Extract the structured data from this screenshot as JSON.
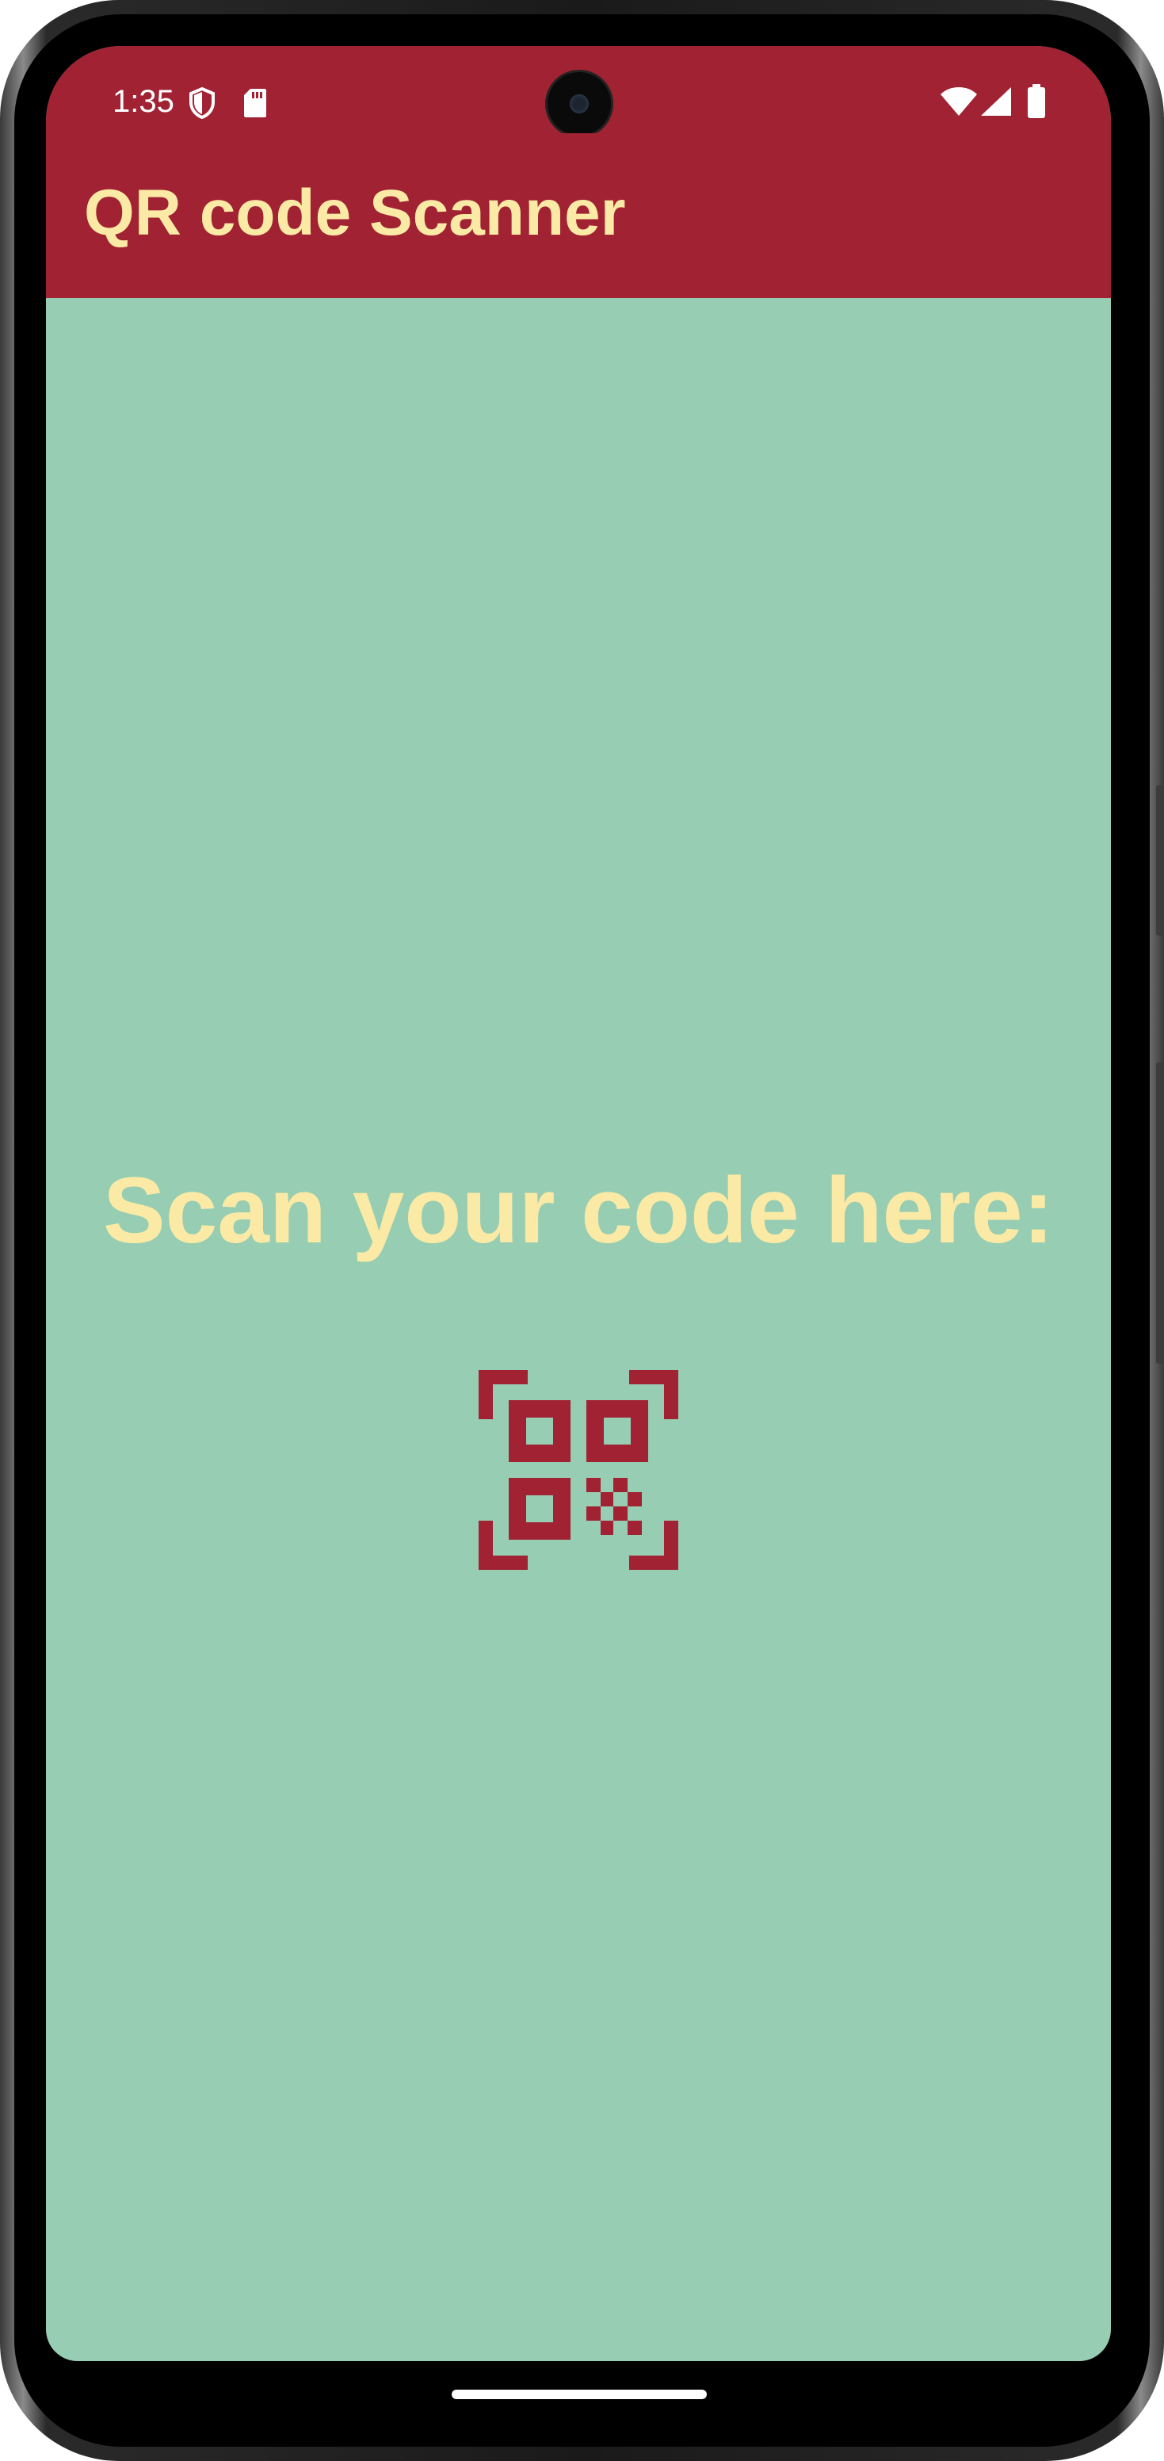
{
  "status_bar": {
    "time": "1:35",
    "icons": [
      "shield-icon",
      "sd-card-icon",
      "wifi-icon",
      "cellular-signal-icon",
      "battery-icon"
    ]
  },
  "app_bar": {
    "title": "QR code Scanner"
  },
  "main": {
    "prompt": "Scan your code here:",
    "scan_icon": "qr-code-scanner-icon"
  },
  "colors": {
    "primary": "#a02233",
    "background": "#97cdb2",
    "accent_text": "#fbeaa6"
  }
}
